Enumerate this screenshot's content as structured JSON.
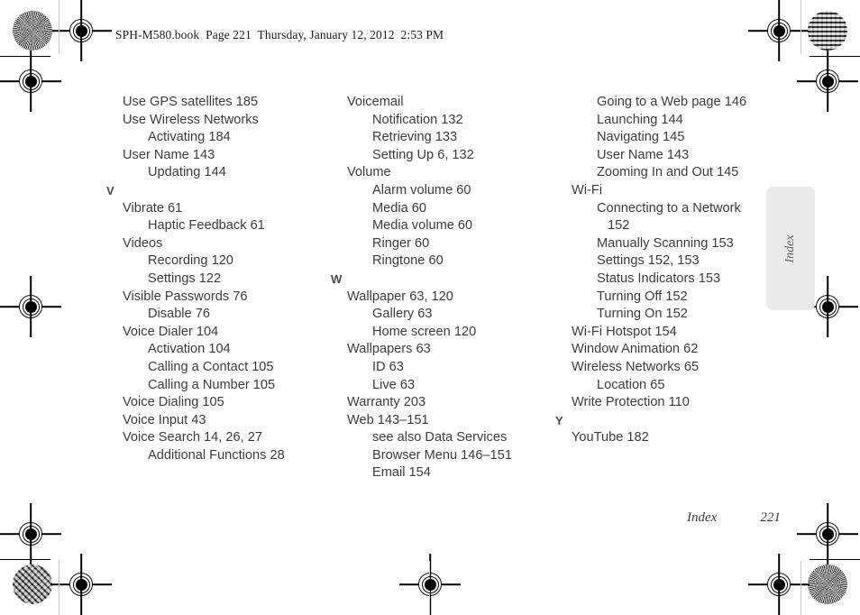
{
  "header": {
    "text": "SPH-M580.book  Page 221  Thursday, January 12, 2012  2:53 PM"
  },
  "side_tab": {
    "label": "Index"
  },
  "footer": {
    "section": "Index",
    "page_number": "221"
  },
  "columns": [
    {
      "id": "column-1",
      "blocks": [
        {
          "type": "entry",
          "level": 1,
          "text": "Use GPS satellites 185"
        },
        {
          "type": "entry",
          "level": 1,
          "text": "Use Wireless Networks"
        },
        {
          "type": "entry",
          "level": 2,
          "text": "Activating 184"
        },
        {
          "type": "entry",
          "level": 1,
          "text": "User Name 143"
        },
        {
          "type": "entry",
          "level": 2,
          "text": "Updating 144"
        },
        {
          "type": "letter",
          "text": "V"
        },
        {
          "type": "entry",
          "level": 1,
          "text": "Vibrate 61"
        },
        {
          "type": "entry",
          "level": 2,
          "text": "Haptic Feedback 61"
        },
        {
          "type": "entry",
          "level": 1,
          "text": "Videos"
        },
        {
          "type": "entry",
          "level": 2,
          "text": "Recording 120"
        },
        {
          "type": "entry",
          "level": 2,
          "text": "Settings 122"
        },
        {
          "type": "entry",
          "level": 1,
          "text": "Visible Passwords 76"
        },
        {
          "type": "entry",
          "level": 2,
          "text": "Disable 76"
        },
        {
          "type": "entry",
          "level": 1,
          "text": "Voice Dialer 104"
        },
        {
          "type": "entry",
          "level": 2,
          "text": "Activation 104"
        },
        {
          "type": "entry",
          "level": 2,
          "text": "Calling a Contact 105"
        },
        {
          "type": "entry",
          "level": 2,
          "text": "Calling a Number 105"
        },
        {
          "type": "entry",
          "level": 1,
          "text": "Voice Dialing 105"
        },
        {
          "type": "entry",
          "level": 1,
          "text": "Voice Input 43"
        },
        {
          "type": "entry",
          "level": 1,
          "text": "Voice Search 14, 26, 27"
        },
        {
          "type": "entry",
          "level": 2,
          "text": "Additional Functions 28"
        }
      ]
    },
    {
      "id": "column-2",
      "blocks": [
        {
          "type": "entry",
          "level": 1,
          "text": "Voicemail"
        },
        {
          "type": "entry",
          "level": 2,
          "text": "Notification 132"
        },
        {
          "type": "entry",
          "level": 2,
          "text": "Retrieving 133"
        },
        {
          "type": "entry",
          "level": 2,
          "text": "Setting Up 6, 132"
        },
        {
          "type": "entry",
          "level": 1,
          "text": "Volume"
        },
        {
          "type": "entry",
          "level": 2,
          "text": "Alarm volume 60"
        },
        {
          "type": "entry",
          "level": 2,
          "text": "Media 60"
        },
        {
          "type": "entry",
          "level": 2,
          "text": "Media volume 60"
        },
        {
          "type": "entry",
          "level": 2,
          "text": "Ringer 60"
        },
        {
          "type": "entry",
          "level": 2,
          "text": "Ringtone 60"
        },
        {
          "type": "letter",
          "text": "W"
        },
        {
          "type": "entry",
          "level": 1,
          "text": "Wallpaper 63, 120"
        },
        {
          "type": "entry",
          "level": 2,
          "text": "Gallery 63"
        },
        {
          "type": "entry",
          "level": 2,
          "text": "Home screen 120"
        },
        {
          "type": "entry",
          "level": 1,
          "text": "Wallpapers 63"
        },
        {
          "type": "entry",
          "level": 2,
          "text": "ID 63"
        },
        {
          "type": "entry",
          "level": 2,
          "text": "Live 63"
        },
        {
          "type": "entry",
          "level": 1,
          "text": "Warranty 203"
        },
        {
          "type": "entry",
          "level": 1,
          "text": "Web 143–151"
        },
        {
          "type": "entry",
          "level": 2,
          "text": "see also Data Services"
        },
        {
          "type": "entry",
          "level": 2,
          "text": "Browser Menu 146–151"
        },
        {
          "type": "entry",
          "level": 2,
          "text": "Email 154"
        }
      ]
    },
    {
      "id": "column-3",
      "blocks": [
        {
          "type": "entry",
          "level": 2,
          "text": "Going to a Web page 146"
        },
        {
          "type": "entry",
          "level": 2,
          "text": "Launching 144"
        },
        {
          "type": "entry",
          "level": 2,
          "text": "Navigating 145"
        },
        {
          "type": "entry",
          "level": 2,
          "text": "User Name 143"
        },
        {
          "type": "entry",
          "level": 2,
          "text": "Zooming In and Out 145"
        },
        {
          "type": "entry",
          "level": 1,
          "text": "Wi-Fi"
        },
        {
          "type": "entry",
          "level": 2,
          "wrapped": true,
          "text": "Connecting to a Network",
          "continuation": "152"
        },
        {
          "type": "entry",
          "level": 2,
          "text": "Manually Scanning 153"
        },
        {
          "type": "entry",
          "level": 2,
          "text": "Settings 152, 153"
        },
        {
          "type": "entry",
          "level": 2,
          "text": "Status Indicators 153"
        },
        {
          "type": "entry",
          "level": 2,
          "text": "Turning Off 152"
        },
        {
          "type": "entry",
          "level": 2,
          "text": "Turning On 152"
        },
        {
          "type": "entry",
          "level": 1,
          "text": "Wi-Fi Hotspot 154"
        },
        {
          "type": "entry",
          "level": 1,
          "text": "Window Animation 62"
        },
        {
          "type": "entry",
          "level": 1,
          "text": "Wireless Networks 65"
        },
        {
          "type": "entry",
          "level": 2,
          "text": "Location 65"
        },
        {
          "type": "entry",
          "level": 1,
          "text": "Write Protection 110"
        },
        {
          "type": "letter",
          "text": "Y"
        },
        {
          "type": "entry",
          "level": 1,
          "text": "YouTube 182"
        }
      ]
    }
  ]
}
